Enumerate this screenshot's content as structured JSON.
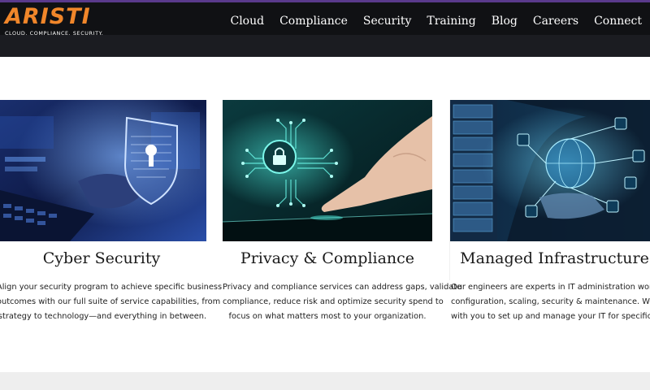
{
  "brand": {
    "name": "ARISTI",
    "tagline": "CLOUD. COMPLIANCE. SECURITY."
  },
  "nav": {
    "items": [
      {
        "label": "Cloud"
      },
      {
        "label": "Compliance"
      },
      {
        "label": "Security"
      },
      {
        "label": "Training"
      },
      {
        "label": "Blog"
      },
      {
        "label": "Careers"
      },
      {
        "label": "Connect"
      }
    ]
  },
  "cards": [
    {
      "title": "Cyber Security",
      "icon": "shield-lock-icon",
      "lines": [
        "Align your security program to achieve specific business",
        "outcomes with our full suite of service capabilities, from",
        "strategy to technology—and everything in between."
      ]
    },
    {
      "title": "Privacy & Compliance",
      "icon": "circuit-lock-icon",
      "lines": [
        "Privacy and compliance services can address gaps, validate",
        "compliance, reduce risk and optimize security spend to",
        "focus on what matters most to your organization."
      ]
    },
    {
      "title": "Managed Infrastructure",
      "icon": "server-globe-icon",
      "lines": [
        "Our engineers are experts in IT administration work like",
        "configuration, scaling, security & maintenance. We'll work",
        "with you to set up and manage your IT for specific tasks."
      ]
    }
  ],
  "colors": {
    "accent": "#f0862a",
    "header_bg": "#101114",
    "top_line": "#5a3a8c"
  }
}
